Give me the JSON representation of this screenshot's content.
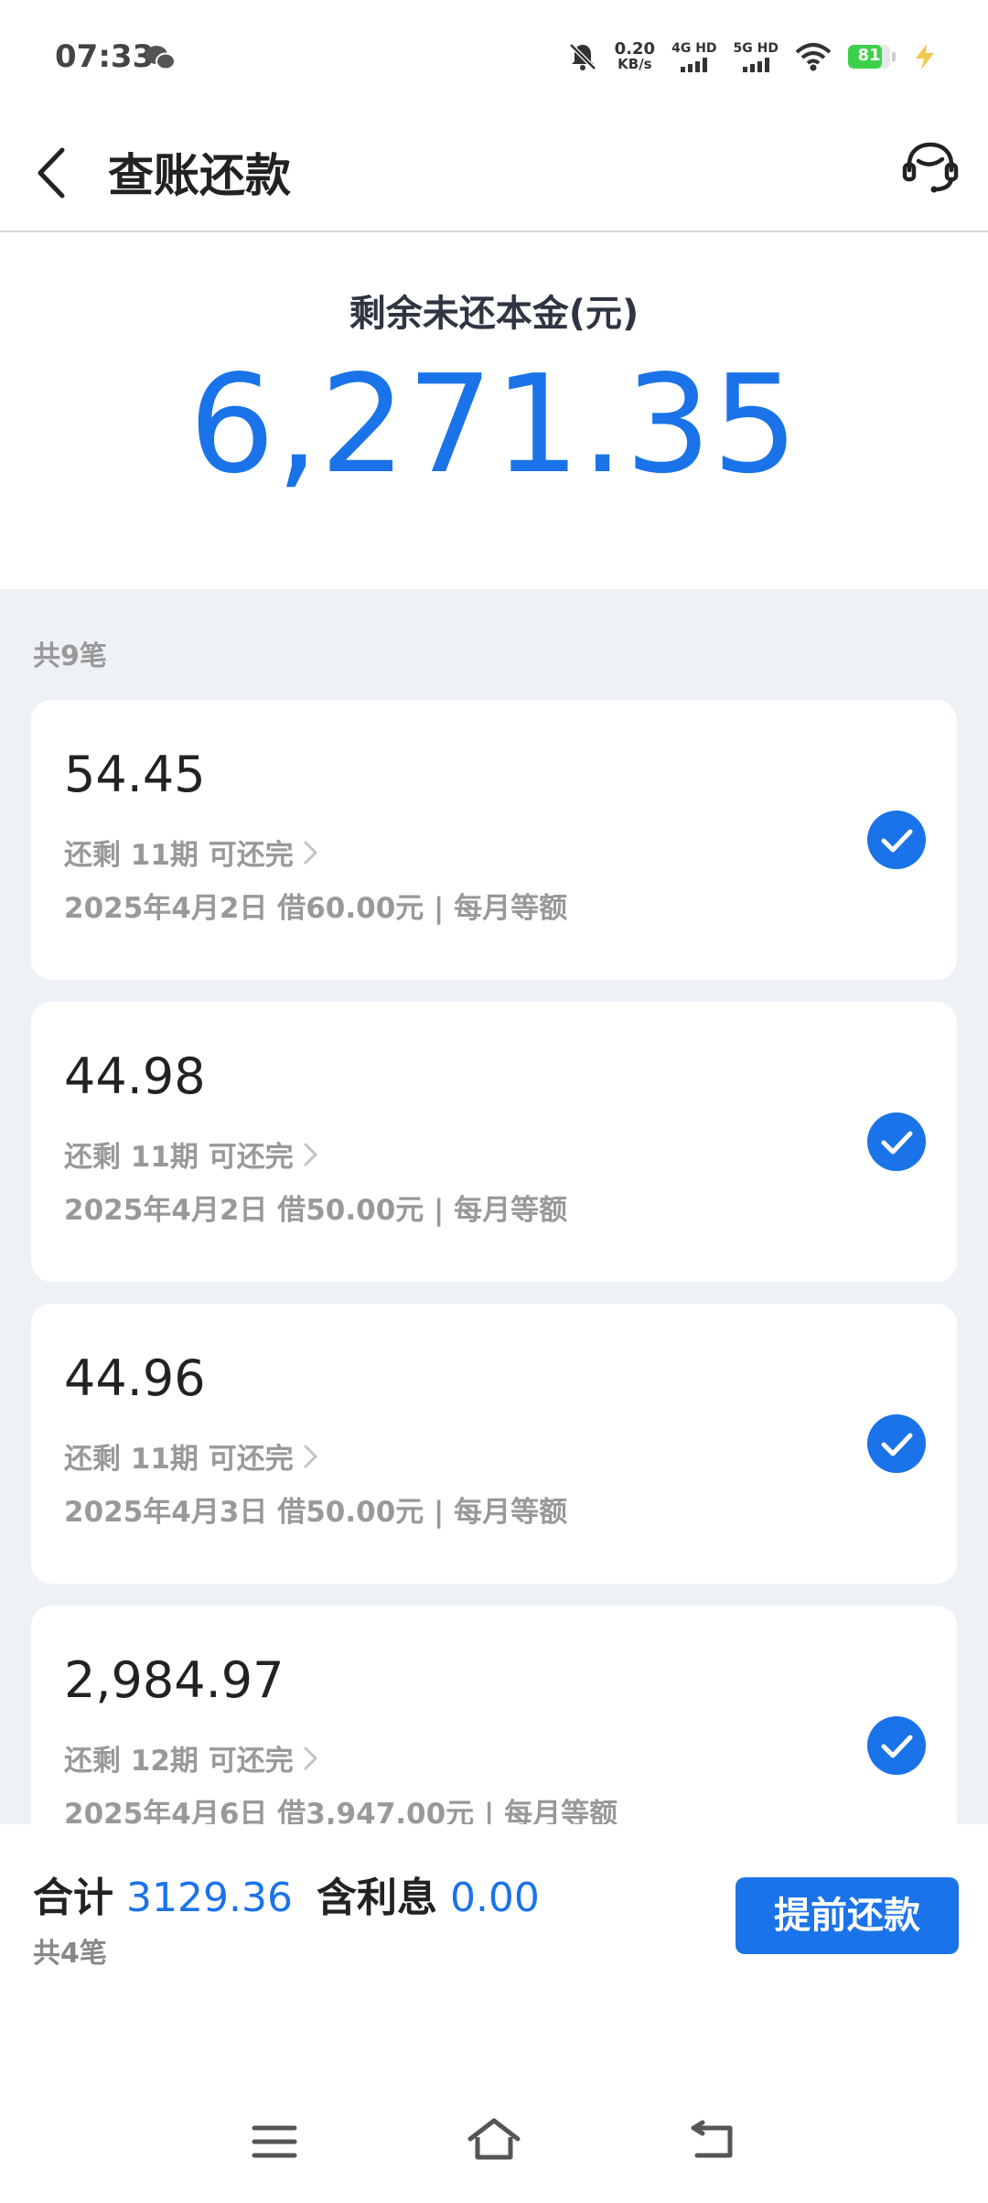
{
  "status_bar": {
    "time": "07:33",
    "net_speed_value": "0.20",
    "net_speed_unit": "KB/s",
    "signal_1_label": "4G HD",
    "signal_2_label": "5G HD",
    "battery_level": "81",
    "battery_color": "#3dd14b"
  },
  "header": {
    "title": "查账还款"
  },
  "summary": {
    "label": "剩余未还本金(元)",
    "amount": "6,271.35"
  },
  "loans": {
    "count_label": "共9笔",
    "items": [
      {
        "amount": "54.45",
        "remain": "还剩 11期 可还完",
        "detail": "2025年4月2日 借60.00元 | 每月等额",
        "selected": true
      },
      {
        "amount": "44.98",
        "remain": "还剩 11期 可还完",
        "detail": "2025年4月2日 借50.00元 | 每月等额",
        "selected": true
      },
      {
        "amount": "44.96",
        "remain": "还剩 11期 可还完",
        "detail": "2025年4月3日 借50.00元 | 每月等额",
        "selected": true
      },
      {
        "amount": "2,984.97",
        "remain": "还剩 12期 可还完",
        "detail": "2025年4月6日 借3,947.00元 | 每月等额",
        "selected": true
      }
    ]
  },
  "footer": {
    "total_label": "合计",
    "total_value": "3129.36",
    "interest_label": "含利息",
    "interest_value": "0.00",
    "selected_count": "共4笔",
    "prepay_button": "提前还款"
  },
  "colors": {
    "accent": "#1a73e8",
    "background": "#eef1f6"
  }
}
